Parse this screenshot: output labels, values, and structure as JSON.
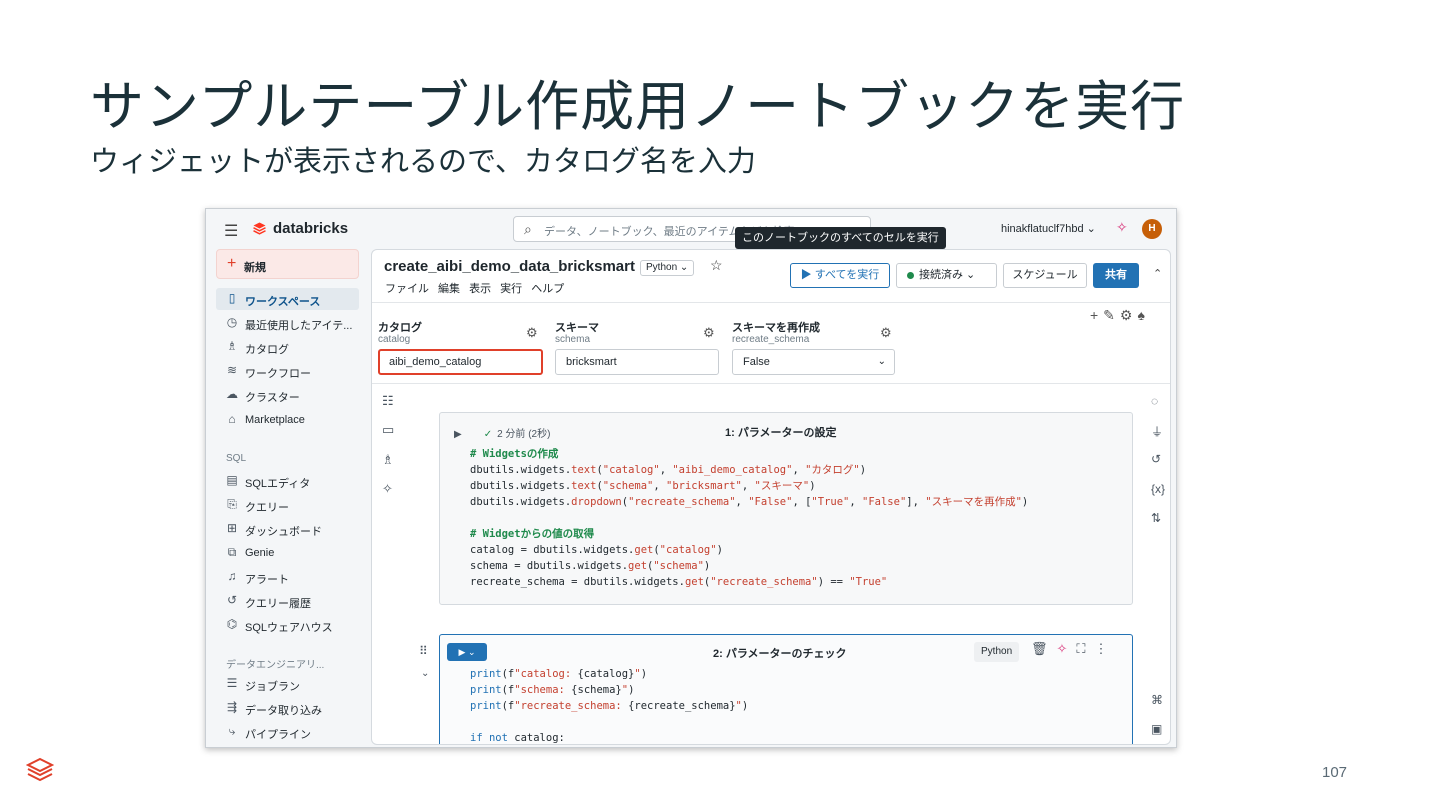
{
  "slide": {
    "title": "サンプルテーブル作成用ノートブックを実行",
    "subtitle": "ウィジェットが表示されるので、カタログ名を入力",
    "page_number": "107"
  },
  "topbar": {
    "brand": "databricks",
    "search_placeholder": "データ、ノートブック、最近のアイテムなどを検索",
    "tooltip": "このノートブックのすべてのセルを実行",
    "user": "hinakflatuclf7hbd ⌄",
    "avatar_initial": "H"
  },
  "sidebar": {
    "new_label": "新規",
    "items": [
      {
        "label": "ワークスペース",
        "icon": "workspace-icon",
        "glyph": "▯"
      },
      {
        "label": "最近使用したアイテ...",
        "icon": "clock-icon",
        "glyph": "◷"
      },
      {
        "label": "カタログ",
        "icon": "catalog-icon",
        "glyph": "♗"
      },
      {
        "label": "ワークフロー",
        "icon": "workflow-icon",
        "glyph": "≋"
      },
      {
        "label": "クラスター",
        "icon": "cloud-icon",
        "glyph": "☁"
      },
      {
        "label": "Marketplace",
        "icon": "store-icon",
        "glyph": "⌂"
      }
    ],
    "sql_section": "SQL",
    "sql_items": [
      {
        "label": "SQLエディタ",
        "icon": "sql-editor-icon",
        "glyph": "▤"
      },
      {
        "label": "クエリー",
        "icon": "query-icon",
        "glyph": "⎘"
      },
      {
        "label": "ダッシュボード",
        "icon": "dashboard-icon",
        "glyph": "⊞"
      },
      {
        "label": "Genie",
        "icon": "genie-icon",
        "glyph": "⧉"
      },
      {
        "label": "アラート",
        "icon": "bell-icon",
        "glyph": "♫"
      },
      {
        "label": "クエリー履歴",
        "icon": "history-icon",
        "glyph": "↺"
      },
      {
        "label": "SQLウェアハウス",
        "icon": "warehouse-icon",
        "glyph": "⌬"
      }
    ],
    "de_section": "データエンジニアリ...",
    "de_items": [
      {
        "label": "ジョブラン",
        "icon": "job-runs-icon",
        "glyph": "☰"
      },
      {
        "label": "データ取り込み",
        "icon": "ingest-icon",
        "glyph": "⇶"
      },
      {
        "label": "パイプライン",
        "icon": "pipeline-icon",
        "glyph": "⤷"
      }
    ]
  },
  "notebook": {
    "title": "create_aibi_demo_data_bricksmart",
    "language": "Python ⌄",
    "menu": "ファイル 編集 表示 実行 ヘルプ",
    "run_all": "▶ すべてを実行",
    "connection": "接続済み ⌄",
    "schedule": "スケジュール",
    "share": "共有"
  },
  "widgets": [
    {
      "label": "カタログ",
      "key": "catalog",
      "value": "aibi_demo_catalog"
    },
    {
      "label": "スキーマ",
      "key": "schema",
      "value": "bricksmart"
    },
    {
      "label": "スキーマを再作成",
      "key": "recreate_schema",
      "value": "False",
      "dropdown_arrow": "⌄"
    }
  ],
  "cells": [
    {
      "status": "2 分前 (2秒)",
      "title": "1: パラメーターの設定"
    },
    {
      "title": "2: パラメーターのチェック",
      "language": "Python"
    }
  ],
  "colors": {
    "accent": "#2272b4",
    "highlight_box": "#e0402a",
    "brand": "#ff3621"
  }
}
